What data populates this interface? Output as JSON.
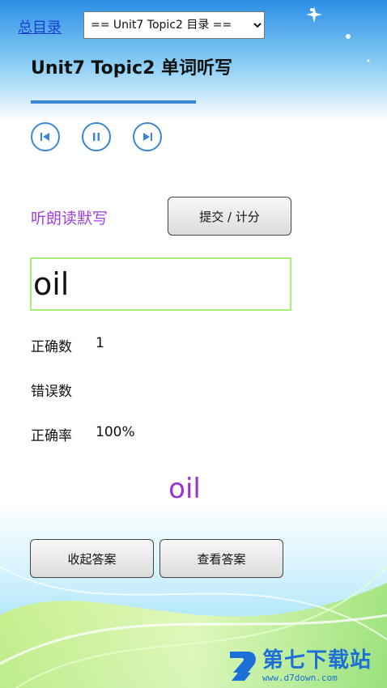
{
  "nav": {
    "home_link": "总目录",
    "topic_select_value": "== Unit7 Topic2 目录 =="
  },
  "title": "Unit7 Topic2 单词听写",
  "player": {
    "progress": 0.5,
    "controls": [
      "previous-icon",
      "pause-icon",
      "next-icon"
    ],
    "accent_color": "#3b86d6"
  },
  "dictation": {
    "mode_label": "听朗读默写",
    "submit_label": "提交 / 计分",
    "input_value": "oil"
  },
  "stats": {
    "correct_label": "正确数",
    "correct_value": "1",
    "wrong_label": "错误数",
    "wrong_value": "",
    "rate_label": "正确率",
    "rate_value": "100%"
  },
  "answer": {
    "word": "oil",
    "color": "#9b30d9"
  },
  "buttons": {
    "hide_answer": "收起答案",
    "show_answer": "查看答案"
  },
  "watermark": {
    "name": "第七下载站",
    "url": "www.d7down.com"
  }
}
